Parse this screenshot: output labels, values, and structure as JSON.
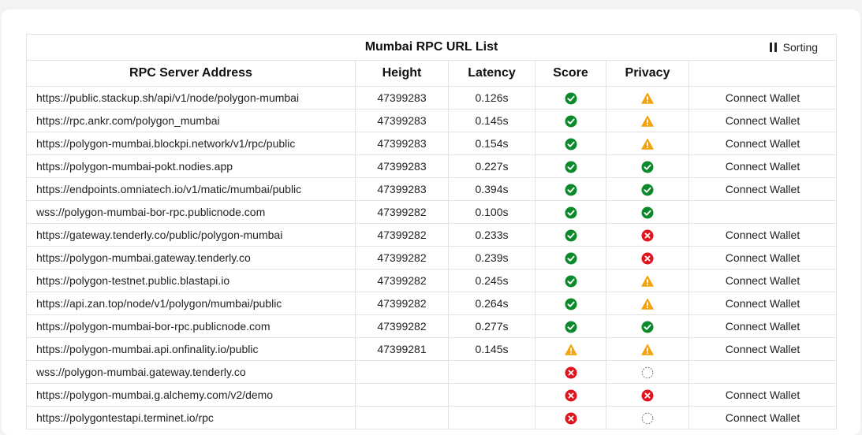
{
  "table": {
    "title": "Mumbai RPC URL List",
    "sorting_label": "Sorting",
    "headers": [
      "RPC Server Address",
      "Height",
      "Latency",
      "Score",
      "Privacy",
      ""
    ],
    "rows": [
      {
        "url": "https://public.stackup.sh/api/v1/node/polygon-mumbai",
        "height": "47399283",
        "latency": "0.126s",
        "score": "ok",
        "privacy": "warn",
        "action": "Connect Wallet"
      },
      {
        "url": "https://rpc.ankr.com/polygon_mumbai",
        "height": "47399283",
        "latency": "0.145s",
        "score": "ok",
        "privacy": "warn",
        "action": "Connect Wallet"
      },
      {
        "url": "https://polygon-mumbai.blockpi.network/v1/rpc/public",
        "height": "47399283",
        "latency": "0.154s",
        "score": "ok",
        "privacy": "warn",
        "action": "Connect Wallet"
      },
      {
        "url": "https://polygon-mumbai-pokt.nodies.app",
        "height": "47399283",
        "latency": "0.227s",
        "score": "ok",
        "privacy": "ok",
        "action": "Connect Wallet"
      },
      {
        "url": "https://endpoints.omniatech.io/v1/matic/mumbai/public",
        "height": "47399283",
        "latency": "0.394s",
        "score": "ok",
        "privacy": "ok",
        "action": "Connect Wallet"
      },
      {
        "url": "wss://polygon-mumbai-bor-rpc.publicnode.com",
        "height": "47399282",
        "latency": "0.100s",
        "score": "ok",
        "privacy": "ok",
        "action": ""
      },
      {
        "url": "https://gateway.tenderly.co/public/polygon-mumbai",
        "height": "47399282",
        "latency": "0.233s",
        "score": "ok",
        "privacy": "error",
        "action": "Connect Wallet"
      },
      {
        "url": "https://polygon-mumbai.gateway.tenderly.co",
        "height": "47399282",
        "latency": "0.239s",
        "score": "ok",
        "privacy": "error",
        "action": "Connect Wallet"
      },
      {
        "url": "https://polygon-testnet.public.blastapi.io",
        "height": "47399282",
        "latency": "0.245s",
        "score": "ok",
        "privacy": "warn",
        "action": "Connect Wallet"
      },
      {
        "url": "https://api.zan.top/node/v1/polygon/mumbai/public",
        "height": "47399282",
        "latency": "0.264s",
        "score": "ok",
        "privacy": "warn",
        "action": "Connect Wallet"
      },
      {
        "url": "https://polygon-mumbai-bor-rpc.publicnode.com",
        "height": "47399282",
        "latency": "0.277s",
        "score": "ok",
        "privacy": "ok",
        "action": "Connect Wallet"
      },
      {
        "url": "https://polygon-mumbai.api.onfinality.io/public",
        "height": "47399281",
        "latency": "0.145s",
        "score": "warn",
        "privacy": "warn",
        "action": "Connect Wallet"
      },
      {
        "url": "wss://polygon-mumbai.gateway.tenderly.co",
        "height": "",
        "latency": "",
        "score": "error",
        "privacy": "unknown",
        "action": ""
      },
      {
        "url": "https://polygon-mumbai.g.alchemy.com/v2/demo",
        "height": "",
        "latency": "",
        "score": "error",
        "privacy": "error",
        "action": "Connect Wallet"
      },
      {
        "url": "https://polygontestapi.terminet.io/rpc",
        "height": "",
        "latency": "",
        "score": "error",
        "privacy": "unknown",
        "action": "Connect Wallet"
      }
    ]
  },
  "status_colors": {
    "ok": "#0a8a2a",
    "warn": "#f2a30f",
    "error": "#e0141e",
    "unknown": "#777777"
  },
  "icon_names": {
    "ok": "check-circle-icon",
    "warn": "warning-triangle-icon",
    "error": "error-x-circle-icon",
    "unknown": "pending-dashed-circle-icon"
  }
}
